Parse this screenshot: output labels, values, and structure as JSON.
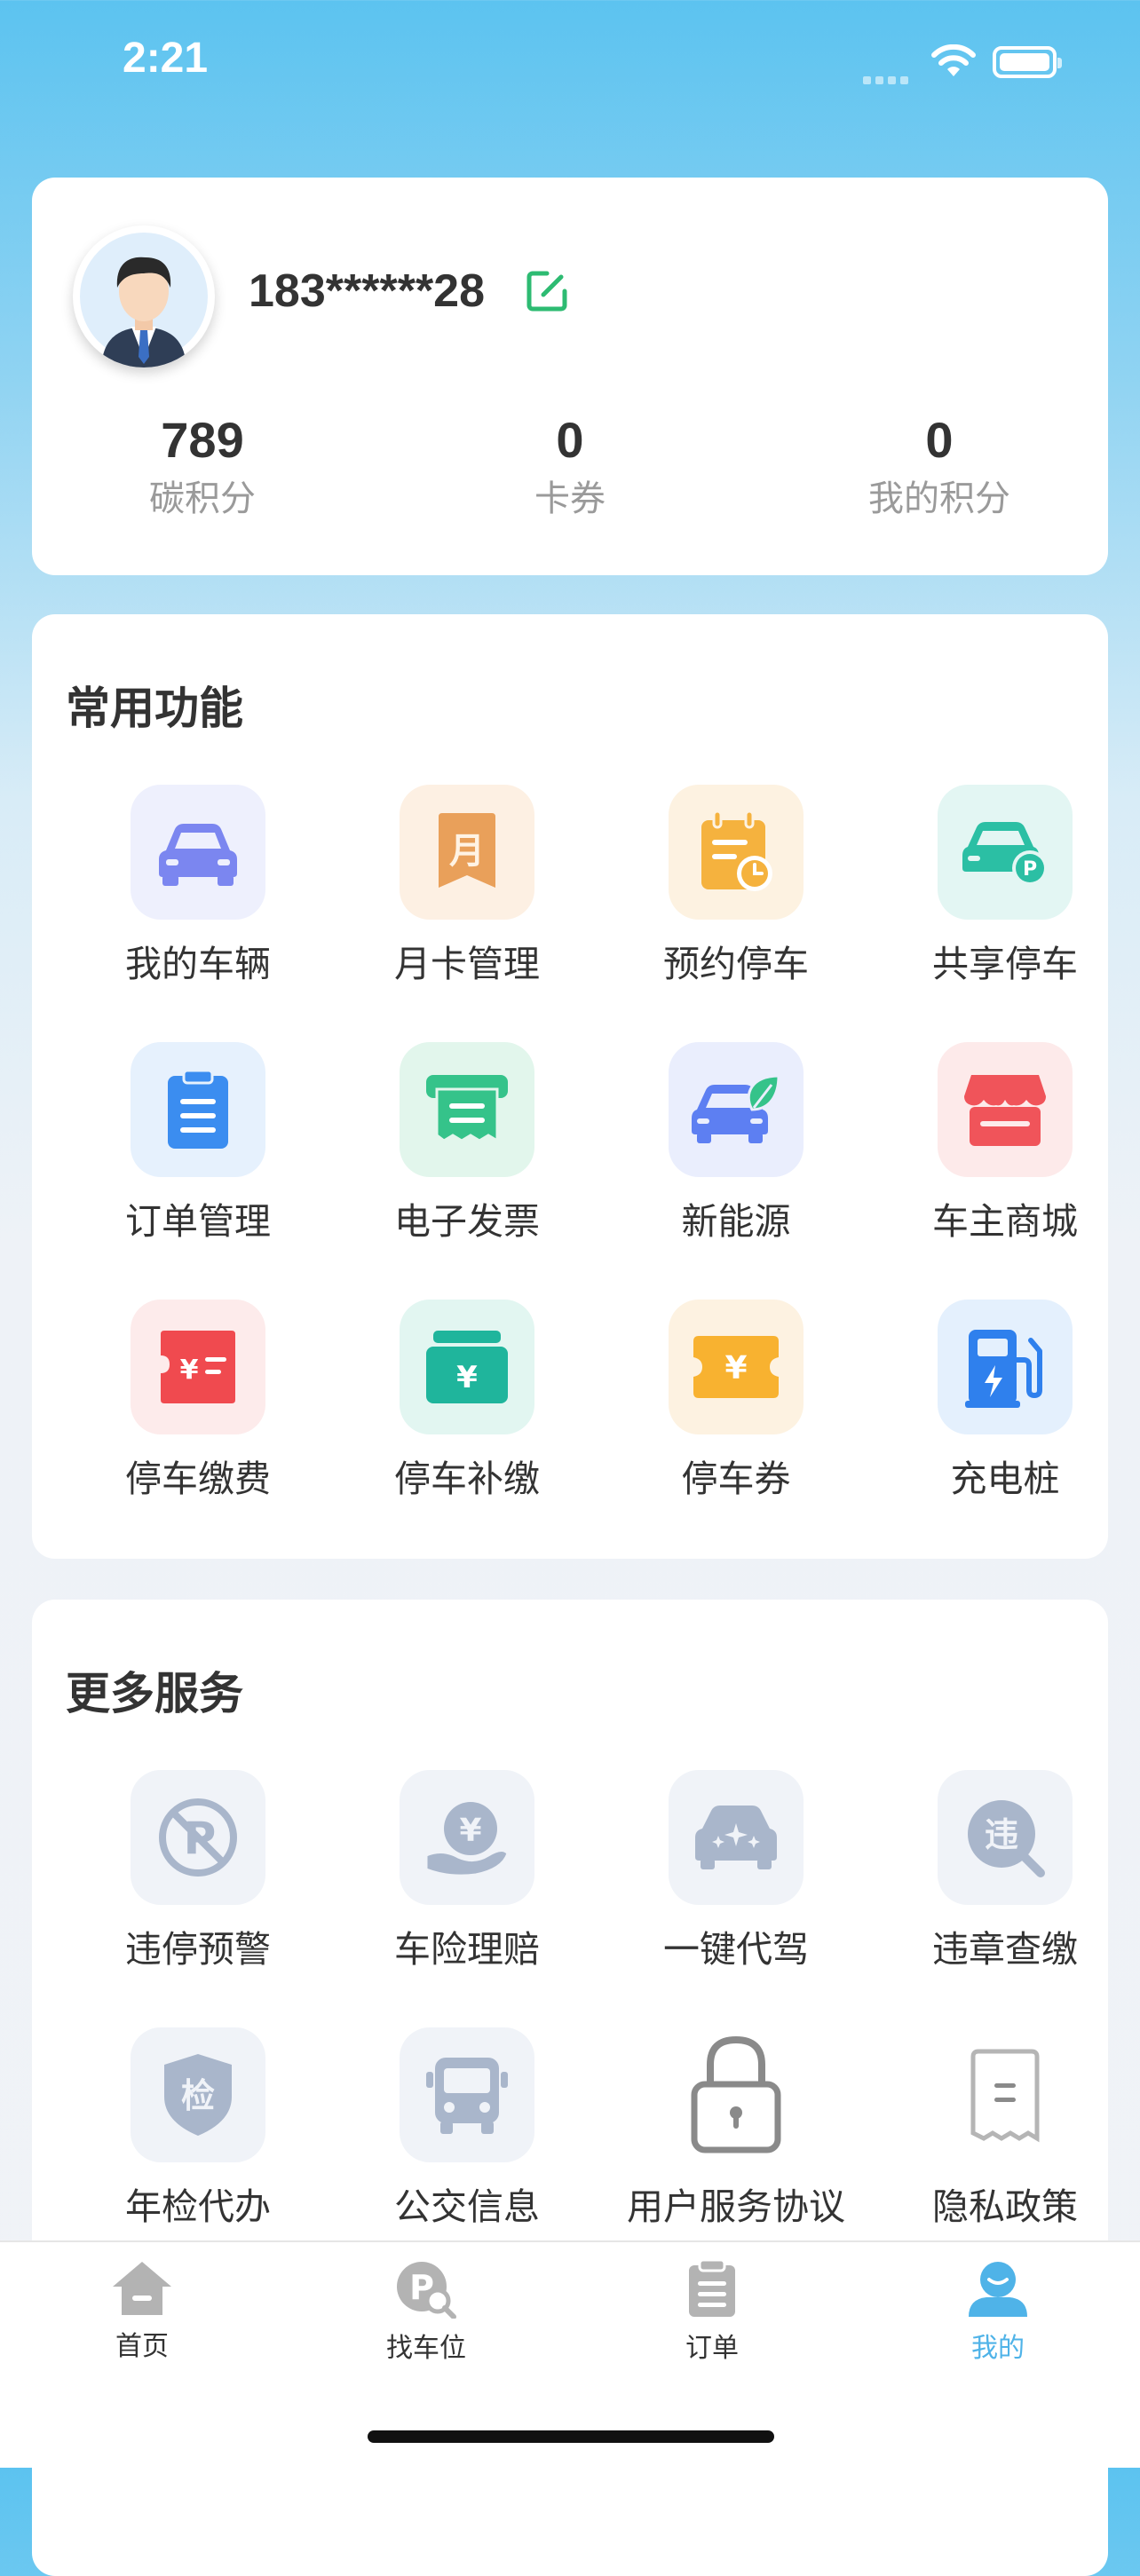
{
  "status_bar": {
    "time": "2:21"
  },
  "profile": {
    "phone": "183******28",
    "stats": [
      {
        "value": "789",
        "label": "碳积分"
      },
      {
        "value": "0",
        "label": "卡券"
      },
      {
        "value": "0",
        "label": "我的积分"
      }
    ]
  },
  "common_functions": {
    "title": "常用功能",
    "items": [
      {
        "label": "我的车辆",
        "icon": "car-icon"
      },
      {
        "label": "月卡管理",
        "icon": "monthly-card-icon"
      },
      {
        "label": "预约停车",
        "icon": "calendar-clock-icon"
      },
      {
        "label": "共享停车",
        "icon": "car-parking-icon"
      },
      {
        "label": "订单管理",
        "icon": "clipboard-icon"
      },
      {
        "label": "电子发票",
        "icon": "receipt-icon"
      },
      {
        "label": "新能源",
        "icon": "eco-car-icon"
      },
      {
        "label": "车主商城",
        "icon": "store-icon"
      },
      {
        "label": "停车缴费",
        "icon": "payment-ticket-icon"
      },
      {
        "label": "停车补缴",
        "icon": "wallet-yen-icon"
      },
      {
        "label": "停车券",
        "icon": "coupon-icon"
      },
      {
        "label": "充电桩",
        "icon": "charging-station-icon"
      }
    ]
  },
  "more_services": {
    "title": "更多服务",
    "items": [
      {
        "label": "违停预警",
        "icon": "no-parking-icon"
      },
      {
        "label": "车险理赔",
        "icon": "hand-yen-icon"
      },
      {
        "label": "一键代驾",
        "icon": "car-sparkle-icon"
      },
      {
        "label": "违章查缴",
        "icon": "violation-search-icon",
        "glyph": "违"
      },
      {
        "label": "年检代办",
        "icon": "inspection-shield-icon",
        "glyph": "检"
      },
      {
        "label": "公交信息",
        "icon": "bus-icon"
      },
      {
        "label": "用户服务协议",
        "icon": "lock-icon"
      },
      {
        "label": "隐私政策",
        "icon": "document-icon"
      }
    ]
  },
  "tabbar": {
    "items": [
      {
        "label": "首页",
        "icon": "home-icon"
      },
      {
        "label": "找车位",
        "icon": "parking-search-icon"
      },
      {
        "label": "订单",
        "icon": "order-clipboard-icon"
      },
      {
        "label": "我的",
        "icon": "user-icon"
      }
    ],
    "active_index": 3,
    "active_color": "#4fb3e8"
  }
}
